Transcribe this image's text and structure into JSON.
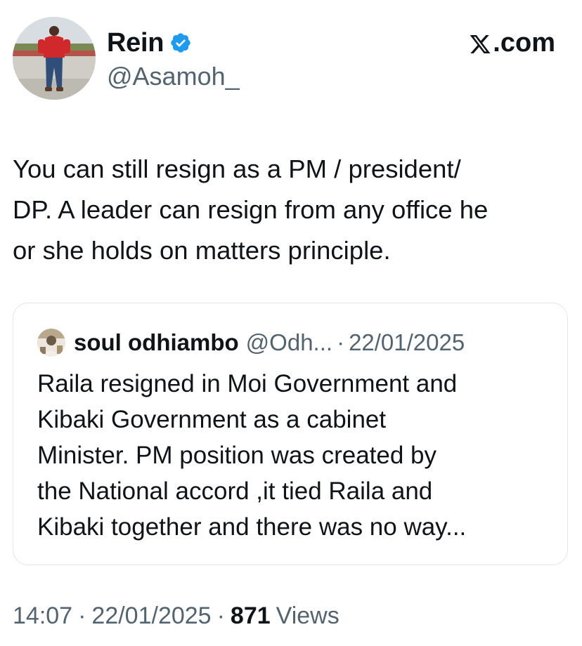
{
  "author": {
    "display_name": "Rein",
    "handle": "@Asamoh_",
    "verified": true,
    "avatar": "profile-photo"
  },
  "site": {
    "label": ".com",
    "logo": "x-logo-icon"
  },
  "tweet": {
    "lines": [
      "You can still resign as a PM / president/",
      "DP. A leader can resign from any office he",
      "or she holds on matters principle."
    ]
  },
  "quote": {
    "display_name": "soul odhiambo",
    "handle": "@Odh...",
    "separator": "·",
    "date": "22/01/2025",
    "avatar": "profile-photo",
    "lines": [
      "Raila resigned in Moi Government and",
      "Kibaki Government as a cabinet",
      "Minister.  PM position was created by",
      "the National accord ,it tied Raila and",
      "Kibaki together and there was no way..."
    ]
  },
  "meta": {
    "time": "14:07",
    "separator": "·",
    "date": "22/01/2025",
    "views_count": "871",
    "views_label": "Views"
  },
  "colors": {
    "verified_badge": "#1d9bf0",
    "secondary_text": "#536471",
    "primary_text": "#0f1419",
    "card_border": "#e1e6ea"
  }
}
